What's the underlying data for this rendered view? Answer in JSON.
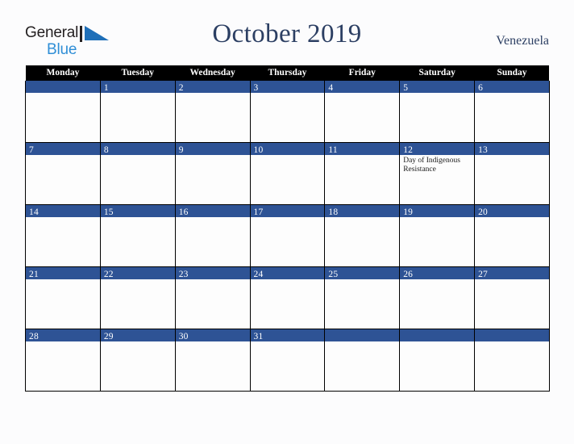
{
  "brand": {
    "name_part1": "General",
    "name_part2": "Blue",
    "mark": "triangle-icon",
    "dark_color": "#231f20",
    "accent_color": "#2f8ed6"
  },
  "header": {
    "title": "October 2019",
    "region": "Venezuela",
    "title_color": "#2c3f63"
  },
  "calendar": {
    "month": "October",
    "year": "2019",
    "week_start": "Monday",
    "header_bg": "#000000",
    "day_band_color": "#2e5395",
    "weekdays": [
      "Monday",
      "Tuesday",
      "Wednesday",
      "Thursday",
      "Friday",
      "Saturday",
      "Sunday"
    ],
    "weeks": [
      [
        {
          "day": "",
          "events": []
        },
        {
          "day": "1",
          "events": []
        },
        {
          "day": "2",
          "events": []
        },
        {
          "day": "3",
          "events": []
        },
        {
          "day": "4",
          "events": []
        },
        {
          "day": "5",
          "events": []
        },
        {
          "day": "6",
          "events": []
        }
      ],
      [
        {
          "day": "7",
          "events": []
        },
        {
          "day": "8",
          "events": []
        },
        {
          "day": "9",
          "events": []
        },
        {
          "day": "10",
          "events": []
        },
        {
          "day": "11",
          "events": []
        },
        {
          "day": "12",
          "events": [
            "Day of Indigenous Resistance"
          ]
        },
        {
          "day": "13",
          "events": []
        }
      ],
      [
        {
          "day": "14",
          "events": []
        },
        {
          "day": "15",
          "events": []
        },
        {
          "day": "16",
          "events": []
        },
        {
          "day": "17",
          "events": []
        },
        {
          "day": "18",
          "events": []
        },
        {
          "day": "19",
          "events": []
        },
        {
          "day": "20",
          "events": []
        }
      ],
      [
        {
          "day": "21",
          "events": []
        },
        {
          "day": "22",
          "events": []
        },
        {
          "day": "23",
          "events": []
        },
        {
          "day": "24",
          "events": []
        },
        {
          "day": "25",
          "events": []
        },
        {
          "day": "26",
          "events": []
        },
        {
          "day": "27",
          "events": []
        }
      ],
      [
        {
          "day": "28",
          "events": []
        },
        {
          "day": "29",
          "events": []
        },
        {
          "day": "30",
          "events": []
        },
        {
          "day": "31",
          "events": []
        },
        {
          "day": "",
          "events": []
        },
        {
          "day": "",
          "events": []
        },
        {
          "day": "",
          "events": []
        }
      ]
    ]
  }
}
